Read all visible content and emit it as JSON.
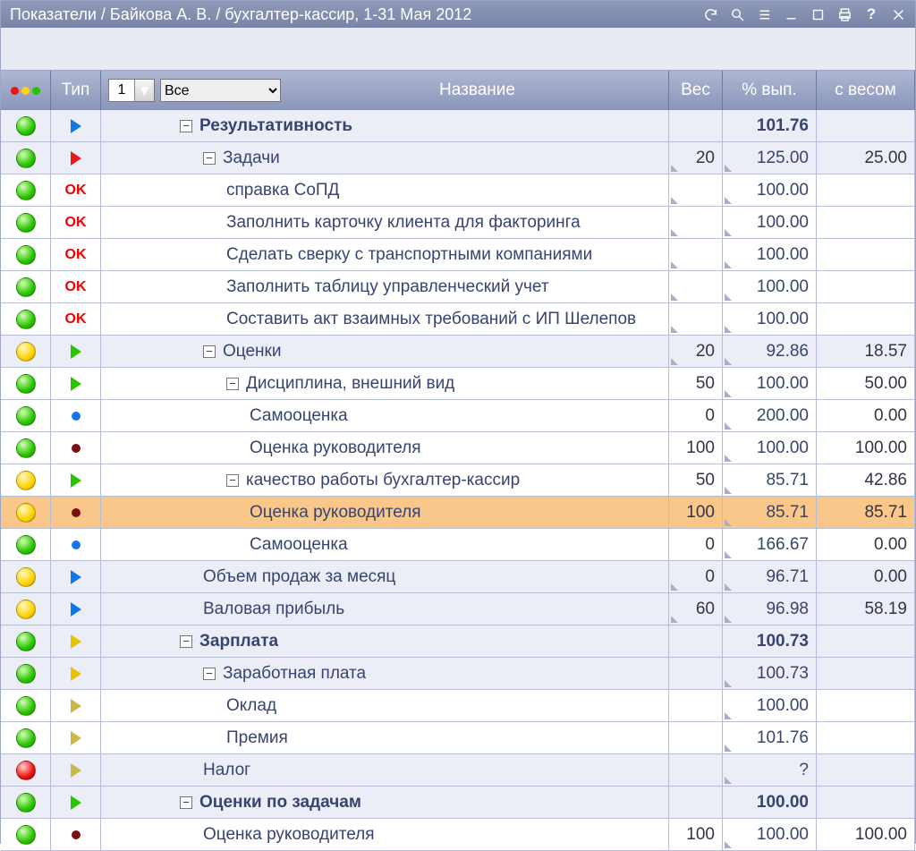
{
  "window_title": "Показатели / Байкова А. В. / бухгалтер-кассир, 1-31 Мая 2012",
  "titlebar_icons": [
    "refresh",
    "search",
    "list",
    "minimize",
    "maximize",
    "print",
    "help",
    "close"
  ],
  "header": {
    "type_label": "Тип",
    "spinner_value": "1",
    "filter_options": [
      "Все"
    ],
    "filter_selected": "Все",
    "name_label": "Название",
    "weight_label": "Вес",
    "pct_label": "% вып.",
    "weighted_label": "с весом"
  },
  "rows": [
    {
      "status": "green",
      "type": "tri-blue",
      "indent": 2,
      "toggle": true,
      "bold": true,
      "name": "Результативность",
      "weight": "",
      "pct": "101.76",
      "weighted": "",
      "bg": "even"
    },
    {
      "status": "green",
      "type": "tri-red",
      "indent": 3,
      "toggle": true,
      "bold": false,
      "name": "Задачи",
      "weight": "20",
      "pct": "125.00",
      "weighted": "25.00",
      "bg": "even",
      "cornerW": true,
      "cornerP": true
    },
    {
      "status": "green",
      "type": "ok",
      "indent": 4,
      "name": "справка СоПД",
      "weight": "",
      "pct": "100.00",
      "weighted": "",
      "bg": "odd",
      "cornerW": true,
      "cornerP": true
    },
    {
      "status": "green",
      "type": "ok",
      "indent": 4,
      "name": "Заполнить карточку клиента для факторинга",
      "weight": "",
      "pct": "100.00",
      "weighted": "",
      "bg": "odd",
      "cornerW": true,
      "cornerP": true
    },
    {
      "status": "green",
      "type": "ok",
      "indent": 4,
      "name": "Сделать сверку с транспортными компаниями",
      "weight": "",
      "pct": "100.00",
      "weighted": "",
      "bg": "odd",
      "cornerW": true,
      "cornerP": true
    },
    {
      "status": "green",
      "type": "ok",
      "indent": 4,
      "name": "Заполнить таблицу управленческий учет",
      "weight": "",
      "pct": "100.00",
      "weighted": "",
      "bg": "odd",
      "cornerW": true,
      "cornerP": true
    },
    {
      "status": "green",
      "type": "ok",
      "indent": 4,
      "name": "Составить акт взаимных требований с ИП Шелепов",
      "weight": "",
      "pct": "100.00",
      "weighted": "",
      "bg": "odd",
      "cornerW": true,
      "cornerP": true
    },
    {
      "status": "yellow",
      "type": "tri-green",
      "indent": 3,
      "toggle": true,
      "name": "Оценки",
      "weight": "20",
      "pct": "92.86",
      "weighted": "18.57",
      "bg": "even",
      "cornerW": true,
      "cornerP": true
    },
    {
      "status": "green",
      "type": "tri-green",
      "indent": 4,
      "toggle": true,
      "name": "Дисциплина, внешний вид",
      "weight": "50",
      "pct": "100.00",
      "weighted": "50.00",
      "bg": "odd",
      "cornerP": true
    },
    {
      "status": "green",
      "type": "dot-blue",
      "indent": 5,
      "name": "Самооценка",
      "weight": "0",
      "pct": "200.00",
      "weighted": "0.00",
      "bg": "odd",
      "cornerP": true
    },
    {
      "status": "green",
      "type": "dot-darkred",
      "indent": 5,
      "name": "Оценка руководителя",
      "weight": "100",
      "pct": "100.00",
      "weighted": "100.00",
      "bg": "odd",
      "cornerP": true
    },
    {
      "status": "yellow",
      "type": "tri-green",
      "indent": 4,
      "toggle": true,
      "name": "качество работы бухгалтер-кассир",
      "weight": "50",
      "pct": "85.71",
      "weighted": "42.86",
      "bg": "odd",
      "cornerP": true
    },
    {
      "status": "yellow",
      "type": "dot-darkred",
      "indent": 5,
      "name": "Оценка руководителя",
      "weight": "100",
      "pct": "85.71",
      "weighted": "85.71",
      "bg": "sel",
      "cornerP": true
    },
    {
      "status": "green",
      "type": "dot-blue",
      "indent": 5,
      "name": "Самооценка",
      "weight": "0",
      "pct": "166.67",
      "weighted": "0.00",
      "bg": "odd",
      "cornerP": true
    },
    {
      "status": "yellow",
      "type": "tri-blue",
      "indent": 3,
      "name": "Объем продаж за месяц",
      "weight": "0",
      "pct": "96.71",
      "weighted": "0.00",
      "bg": "even",
      "cornerW": true,
      "cornerP": true
    },
    {
      "status": "yellow",
      "type": "tri-blue",
      "indent": 3,
      "name": "Валовая прибыль",
      "weight": "60",
      "pct": "96.98",
      "weighted": "58.19",
      "bg": "even",
      "cornerW": true,
      "cornerP": true
    },
    {
      "status": "green",
      "type": "tri-yellow",
      "indent": 2,
      "toggle": true,
      "bold": true,
      "name": "Зарплата",
      "weight": "",
      "pct": "100.73",
      "weighted": "",
      "bg": "even"
    },
    {
      "status": "green",
      "type": "tri-yellow",
      "indent": 3,
      "toggle": true,
      "name": "Заработная плата",
      "weight": "",
      "pct": "100.73",
      "weighted": "",
      "bg": "even",
      "cornerP": true
    },
    {
      "status": "green",
      "type": "tri-hollow",
      "indent": 4,
      "name": "Оклад",
      "weight": "",
      "pct": "100.00",
      "weighted": "",
      "bg": "odd",
      "cornerP": true
    },
    {
      "status": "green",
      "type": "tri-hollow",
      "indent": 4,
      "name": "Премия",
      "weight": "",
      "pct": "101.76",
      "weighted": "",
      "bg": "odd",
      "cornerP": true
    },
    {
      "status": "red",
      "type": "tri-hollow",
      "indent": 3,
      "name": "Налог",
      "weight": "",
      "pct": "?",
      "weighted": "",
      "bg": "even",
      "cornerP": true
    },
    {
      "status": "green",
      "type": "tri-green",
      "indent": 2,
      "toggle": true,
      "bold": true,
      "name": "Оценки по задачам",
      "weight": "",
      "pct": "100.00",
      "weighted": "",
      "bg": "even"
    },
    {
      "status": "green",
      "type": "dot-darkred",
      "indent": 3,
      "name": "Оценка руководителя",
      "weight": "100",
      "pct": "100.00",
      "weighted": "100.00",
      "bg": "odd",
      "cornerP": true
    }
  ]
}
